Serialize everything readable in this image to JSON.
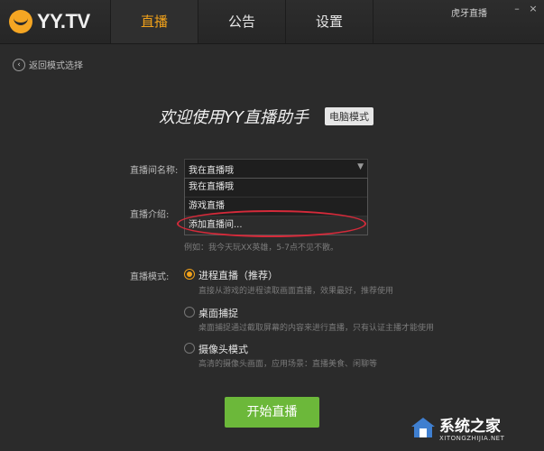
{
  "header": {
    "logo_text": "YY.TV",
    "tabs": [
      {
        "label": "直播"
      },
      {
        "label": "公告"
      },
      {
        "label": "设置"
      }
    ],
    "window_title": "虎牙直播",
    "minimize_glyph": "–",
    "close_glyph": "×"
  },
  "back": {
    "label": "返回模式选择",
    "icon": "back-arrow-icon"
  },
  "welcome": {
    "title": "欢迎使用YY直播助手",
    "mode_badge": "电脑模式"
  },
  "form": {
    "room_name_label": "直播间名称:",
    "room_name_value": "我在直播哦",
    "dropdown_options": [
      "我在直播哦",
      "游戏直播",
      "添加直播间..."
    ],
    "intro_label": "直播介绍:",
    "example_text": "例如：我今天玩XX英雄，5-7点不见不散。",
    "mode_label": "直播模式:"
  },
  "modes": [
    {
      "title": "进程直播（推荐）",
      "desc": "直接从游戏的进程读取画面直播，效果最好，推荐使用",
      "selected": true
    },
    {
      "title": "桌面捕捉",
      "desc": "桌面捕捉通过截取屏幕的内容来进行直播，只有认证主播才能使用",
      "selected": false
    },
    {
      "title": "摄像头模式",
      "desc": "高清的摄像头画面，应用场景：直播美食、闲聊等",
      "selected": false
    }
  ],
  "start_button": "开始直播",
  "watermark": {
    "main": "系统之家",
    "sub": "XITONGZHIJIA.NET"
  },
  "colors": {
    "accent": "#f2a21a",
    "start": "#6cb83a",
    "highlight": "#d42a3a",
    "background": "#2b2b2b"
  }
}
